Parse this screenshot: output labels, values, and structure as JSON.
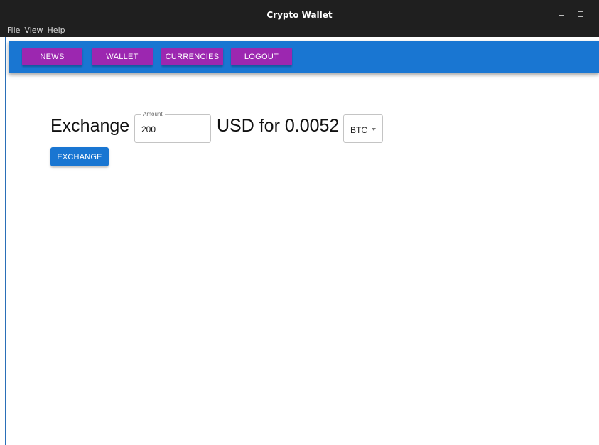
{
  "window": {
    "title": "Crypto Wallet",
    "controls": {
      "minimize_icon": "minimize-icon",
      "maximize_icon": "maximize-icon"
    }
  },
  "menubar": {
    "items": [
      "File",
      "View",
      "Help"
    ]
  },
  "appbar": {
    "color": "#1976d2",
    "nav_button_color": "#9c27b0",
    "buttons": [
      "NEWS",
      "WALLET",
      "CURRENCIES",
      "LOGOUT"
    ]
  },
  "exchange_form": {
    "lead_text": "Exchange",
    "amount_label": "Amount",
    "amount_value": "200",
    "result_text": "USD for 0.0052",
    "currency": {
      "selected": "BTC",
      "caret_icon": "caret-down-icon"
    },
    "submit_label": "EXCHANGE"
  }
}
